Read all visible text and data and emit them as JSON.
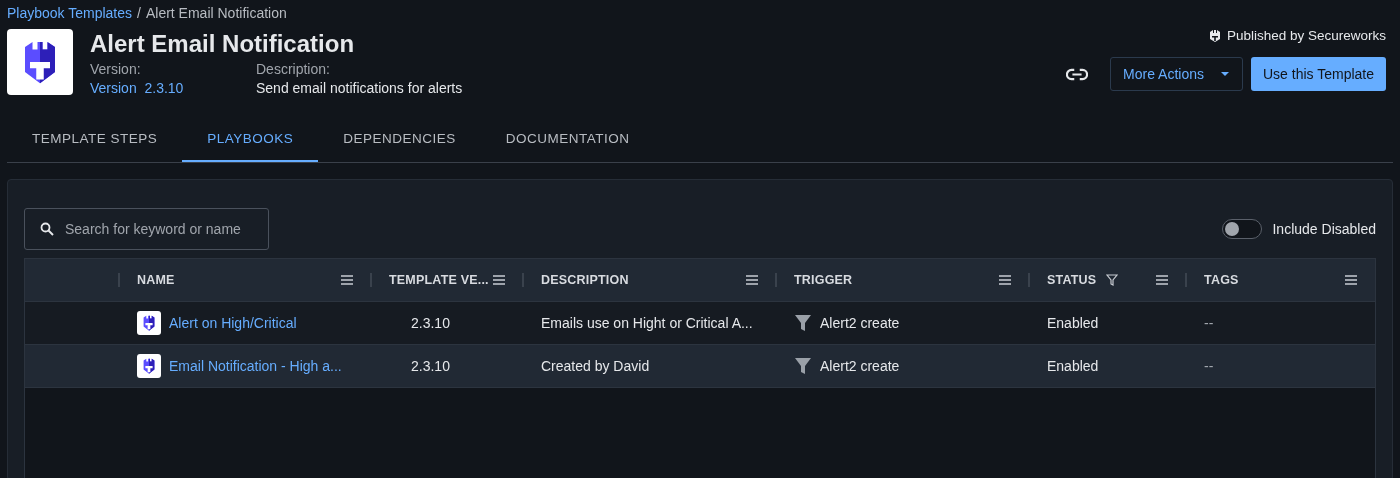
{
  "breadcrumb": {
    "parent": "Playbook Templates",
    "separator": "/",
    "current": "Alert Email Notification"
  },
  "header": {
    "title": "Alert Email Notification",
    "version_label": "Version:",
    "version_prefix": "Version",
    "version": "2.3.10",
    "description_label": "Description:",
    "description": "Send email notifications for alerts",
    "publisher": "Published by Secureworks"
  },
  "actions": {
    "more": "More Actions",
    "use": "Use this Template"
  },
  "tabs": [
    {
      "label": "TEMPLATE STEPS",
      "selected": false
    },
    {
      "label": "PLAYBOOKS",
      "selected": true
    },
    {
      "label": "DEPENDENCIES",
      "selected": false
    },
    {
      "label": "DOCUMENTATION",
      "selected": false
    }
  ],
  "search": {
    "placeholder": "Search for keyword or name"
  },
  "include_disabled": {
    "label": "Include Disabled",
    "on": false
  },
  "table": {
    "columns": [
      {
        "label": "NAME",
        "filter": false
      },
      {
        "label": "TEMPLATE VE...",
        "filter": false
      },
      {
        "label": "DESCRIPTION",
        "filter": false
      },
      {
        "label": "TRIGGER",
        "filter": false
      },
      {
        "label": "STATUS",
        "filter": true
      },
      {
        "label": "TAGS",
        "filter": false
      }
    ],
    "rows": [
      {
        "name": "Alert on High/Critical",
        "version": "2.3.10",
        "description": "Emails use on Hight or Critical A...",
        "trigger": "Alert2 create",
        "status": "Enabled",
        "tags": "--",
        "selected": false
      },
      {
        "name": "Email Notification - High a...",
        "version": "2.3.10",
        "description": "Created by David",
        "trigger": "Alert2 create",
        "status": "Enabled",
        "tags": "--",
        "selected": true
      }
    ]
  }
}
